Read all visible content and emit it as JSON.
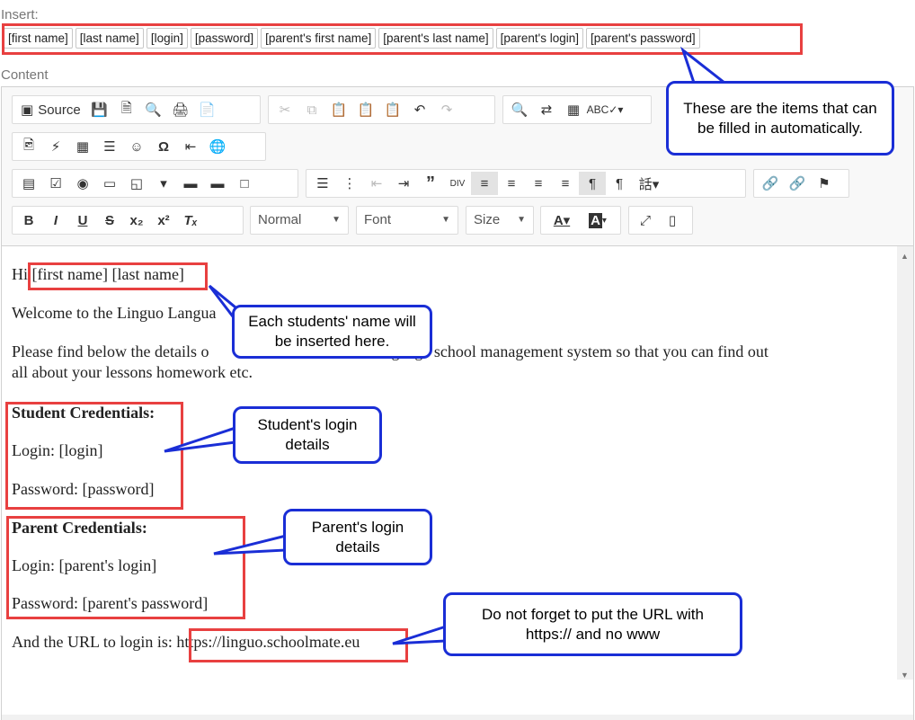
{
  "insert_label": "Insert:",
  "content_label": "Content",
  "placeholders": [
    "[first name]",
    "[last name]",
    "[login]",
    "[password]",
    "[parent's first name]",
    "[parent's last name]",
    "[parent's login]",
    "[parent's password]"
  ],
  "toolbar": {
    "source_label": "Source",
    "format_combo": "Normal",
    "font_combo": "Font",
    "size_combo": "Size"
  },
  "body": {
    "greeting_prefix": "Hi",
    "greeting_names": "[first name] [last name]",
    "welcome": "Welcome to the Linguo Langua",
    "details": "Please find below the details o",
    "details_tail": "anguage school management system so that you can find out",
    "details_line2": "all about your lessons homework etc.",
    "student_heading": "Student Credentials:",
    "student_login": "Login: [login]",
    "student_password": "Password: [password]",
    "parent_heading": "Parent Credentials:",
    "parent_login": "Login: [parent's login]",
    "parent_password_prefix": "Password:",
    "parent_password_value": "[parent's password]",
    "url_prefix": "And the URL to login is:",
    "url_value": "https://linguo.schoolmate.eu"
  },
  "callouts": {
    "items": "These are the items that can be filled in automatically.",
    "name": "Each students' name will be inserted here.",
    "student": "Student's login details",
    "parent": "Parent's login details",
    "url": "Do not forget to put the URL with https:// and no www"
  },
  "colors": {
    "annotation_red": "#e84040",
    "callout_blue": "#1a2ed6"
  }
}
